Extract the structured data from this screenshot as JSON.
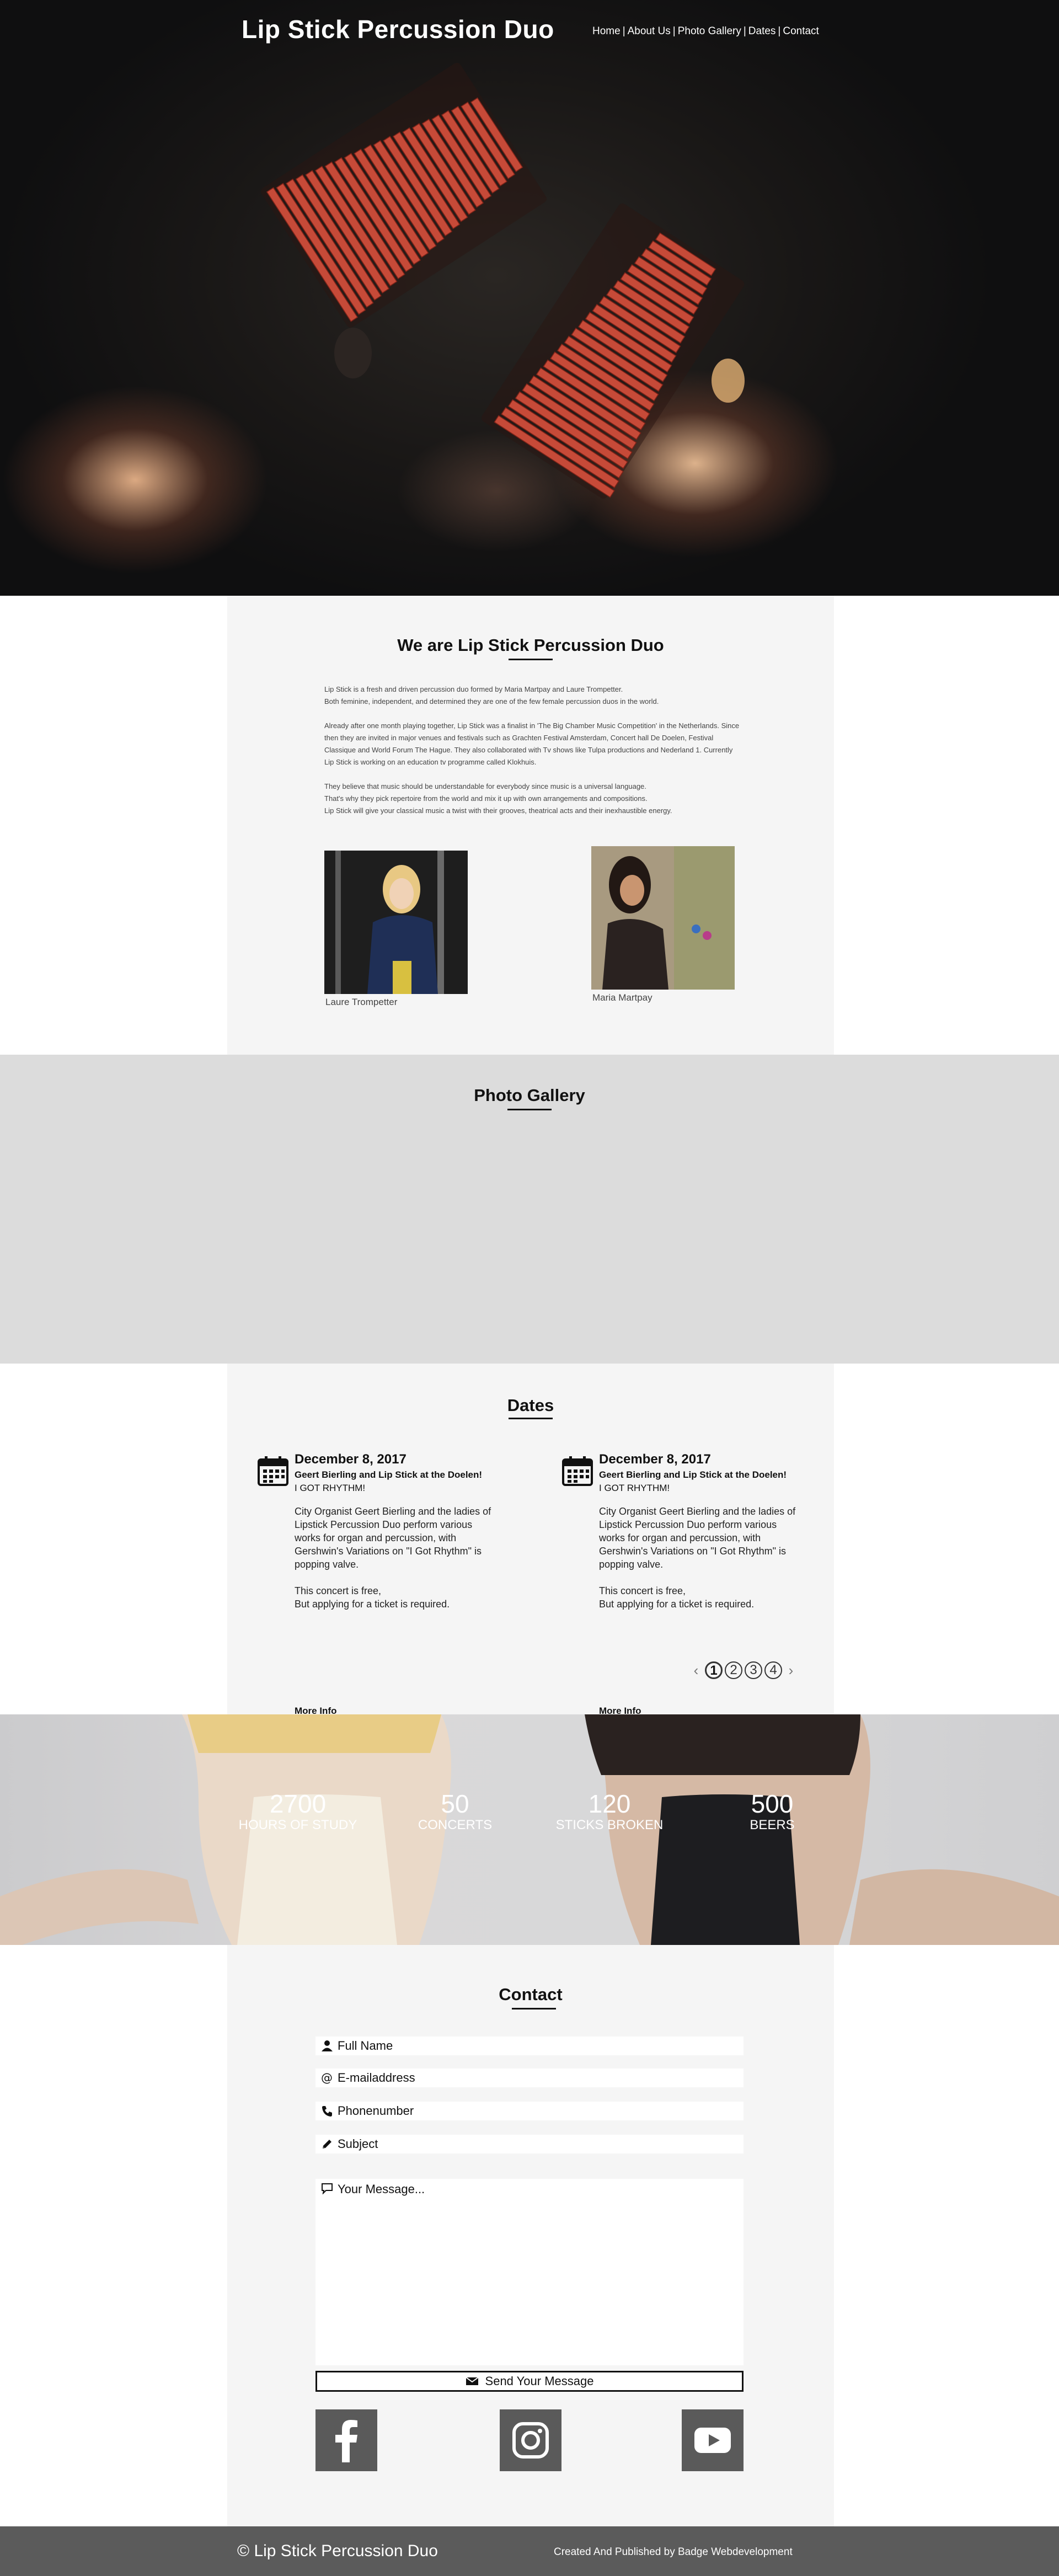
{
  "header": {
    "site_title": "Lip Stick Percussion Duo",
    "nav": [
      "Home",
      "About Us",
      "Photo Gallery",
      "Dates",
      "Contact"
    ]
  },
  "about": {
    "title": "We are Lip Stick Percussion Duo",
    "paragraphs": [
      "Lip Stick is a fresh and driven percussion duo formed by Maria Martpay and Laure Trompetter.\nBoth feminine, independent, and determined they are one of the few female percussion duos in the world.",
      "Already after one month playing together, Lip Stick was a finalist in 'The Big Chamber Music Competition' in the Netherlands. Since then they are invited in major venues and festivals such as Grachten Festival Amsterdam, Concert hall De Doelen, Festival Classique and World Forum The Hague. They also collaborated with Tv shows like Tulpa productions and Nederland 1. Currently Lip Stick is working on an education tv programme called Klokhuis.",
      "They believe that music should be understandable for everybody since music is a universal language.\nThat's why they pick repertoire from the world and mix it up with own arrangements and compositions.\nLip Stick will give your classical music a twist with their grooves, theatrical acts and their inexhaustible energy."
    ],
    "members": [
      {
        "name": "Laure Trompetter"
      },
      {
        "name": "Maria Martpay"
      }
    ]
  },
  "gallery": {
    "title": "Photo Gallery"
  },
  "dates": {
    "title": "Dates",
    "events": [
      {
        "date": "December 8, 2017",
        "title": "Geert Bierling and Lip Stick at the Doelen!",
        "subtitle": "I GOT RHYTHM!",
        "desc1": "City Organist Geert Bierling and the ladies of Lipstick Percussion Duo perform various works for organ and percussion, with Gershwin's Variations on \"I Got Rhythm\" is popping valve.",
        "desc2": "This concert is free,\nBut applying for a ticket is required.",
        "more": "More Info"
      },
      {
        "date": "December 8, 2017",
        "title": "Geert Bierling and Lip Stick at the Doelen!",
        "subtitle": "I GOT RHYTHM!",
        "desc1": "City Organist Geert Bierling and the ladies of Lipstick Percussion Duo perform various works for organ and percussion, with Gershwin's Variations on \"I Got Rhythm\" is popping valve.",
        "desc2": "This concert is free,\nBut applying for a ticket is required.",
        "more": "More Info"
      }
    ],
    "pager": {
      "prev": "‹",
      "pages": [
        "1",
        "2",
        "3",
        "4"
      ],
      "active": "1",
      "next": "›"
    }
  },
  "stats": [
    {
      "number": "2700",
      "label": "HOURS OF STUDY"
    },
    {
      "number": "50",
      "label": "CONCERTS"
    },
    {
      "number": "120",
      "label": "STICKS BROKEN"
    },
    {
      "number": "500",
      "label": "BEERS"
    }
  ],
  "contact": {
    "title": "Contact",
    "fields": {
      "name": "Full Name",
      "email": "E-mailaddress",
      "phone": "Phonenumber",
      "subject": "Subject",
      "message": "Your Message..."
    },
    "send_label": "Send Your Message"
  },
  "footer": {
    "left": "© Lip Stick Percussion Duo",
    "right": "Created And Published by Badge Webdevelopment"
  }
}
